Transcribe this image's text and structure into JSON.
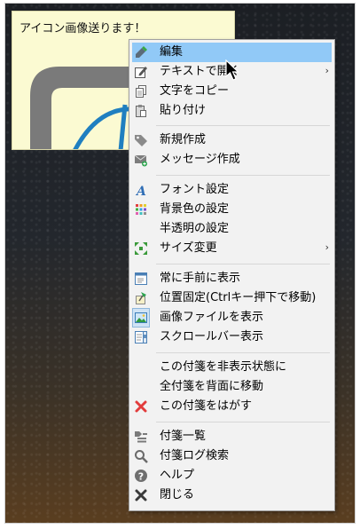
{
  "note": {
    "title": "アイコン画像送ります！"
  },
  "menu": {
    "items": [
      {
        "label": "編集",
        "icon": "pencil-icon",
        "highlighted": true
      },
      {
        "label": "テキストで開く",
        "icon": "edit-icon",
        "submenu": true
      },
      {
        "label": "文字をコピー",
        "icon": "copy-icon"
      },
      {
        "label": "貼り付け",
        "icon": "paste-icon"
      },
      {
        "label": "新規作成",
        "icon": "tag-icon"
      },
      {
        "label": "メッセージ作成",
        "icon": "mail-icon"
      },
      {
        "label": "フォント設定",
        "icon": "font-icon"
      },
      {
        "label": "背景色の設定",
        "icon": "palette-icon"
      },
      {
        "label": "半透明の設定",
        "icon": "none"
      },
      {
        "label": "サイズ変更",
        "icon": "resize-icon",
        "submenu": true
      },
      {
        "label": "常に手前に表示",
        "icon": "window-top-icon"
      },
      {
        "label": "位置固定(Ctrlキー押下で移動)",
        "icon": "pin-icon"
      },
      {
        "label": "画像ファイルを表示",
        "icon": "image-icon",
        "checked": true
      },
      {
        "label": "スクロールバー表示",
        "icon": "scrollbar-icon"
      },
      {
        "label": "この付箋を非表示状態に",
        "icon": "none"
      },
      {
        "label": "全付箋を背面に移動",
        "icon": "none"
      },
      {
        "label": "この付箋をはがす",
        "icon": "red-x-icon"
      },
      {
        "label": "付箋一覧",
        "icon": "list-icon"
      },
      {
        "label": "付箋ログ検索",
        "icon": "search-icon"
      },
      {
        "label": "ヘルプ",
        "icon": "help-icon"
      },
      {
        "label": "閉じる",
        "icon": "close-icon"
      }
    ],
    "submenu_arrow": "›"
  },
  "colors": {
    "highlight": "#91c9f7",
    "note_bg": "#fbfad2",
    "menu_bg": "#f2f2f2"
  }
}
